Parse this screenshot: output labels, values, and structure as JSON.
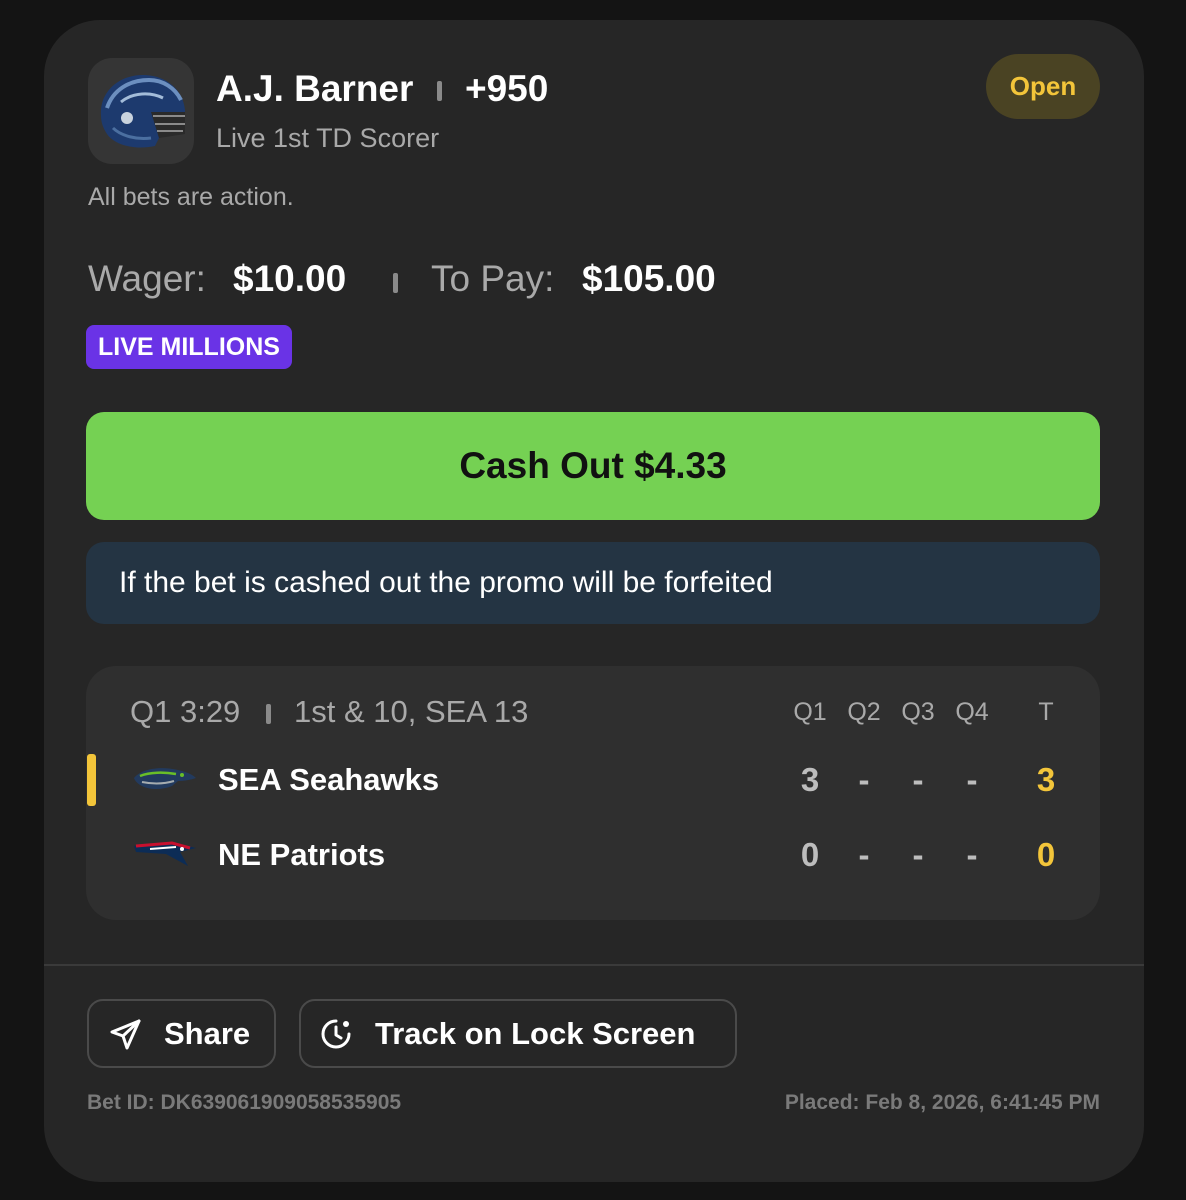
{
  "bet": {
    "player": "A.J. Barner",
    "odds": "+950",
    "market": "Live 1st TD Scorer",
    "status": "Open",
    "action_note": "All bets are action.",
    "wager_label": "Wager:",
    "wager_value": "$10.00",
    "topay_label": "To Pay:",
    "topay_value": "$105.00",
    "promo": "LIVE MILLIONS",
    "cashout_label": "Cash Out $4.33",
    "promo_warning": "If the bet is cashed out the promo will be forfeited"
  },
  "game": {
    "clock": "Q1 3:29",
    "down_distance": "1st & 10, SEA 13",
    "columns": [
      "Q1",
      "Q2",
      "Q3",
      "Q4",
      "T"
    ],
    "teams": [
      {
        "name": "SEA Seahawks",
        "logo": "seahawks-logo",
        "scores": [
          "3",
          "-",
          "-",
          "-"
        ],
        "total": "3",
        "possession": true
      },
      {
        "name": "NE Patriots",
        "logo": "patriots-logo",
        "scores": [
          "0",
          "-",
          "-",
          "-"
        ],
        "total": "0",
        "possession": false
      }
    ]
  },
  "actions": {
    "share_label": "Share",
    "share_icon": "send-icon",
    "track_label": "Track on Lock Screen",
    "track_icon": "lock-timer-icon"
  },
  "footer": {
    "bet_id": "Bet ID: DK639061909058535905",
    "placed": "Placed: Feb 8, 2026, 6:41:45 PM"
  },
  "colors": {
    "cashout": "#75d153",
    "promo_badge": "#6a33e6",
    "status_text": "#f3c53a",
    "warning_bg": "#243443"
  }
}
